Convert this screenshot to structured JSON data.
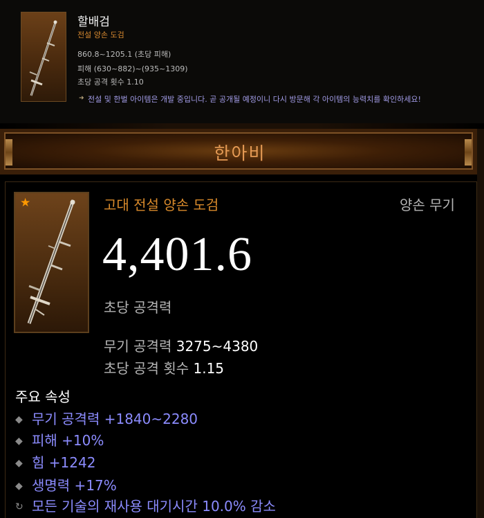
{
  "top_card": {
    "item_name": "할배검",
    "item_type": "전설 양손 도검",
    "line1": "860.8~1205.1 (초당 피해)",
    "line2": "피해 (630~882)~(935~1309)",
    "line3": "초당 공격 횟수 1.10",
    "notice": "전설 및 한벌 아이템은 개발 중입니다. 곧 공개될 예정이니 다시 방문해 각 아이템의 능력치를 확인하세요!",
    "notice_bullet": "➜"
  },
  "tooltip": {
    "header_title": "한아비",
    "item_type": "고대 전설 양손 도검",
    "slot": "양손 무기",
    "dps": "4,401.6",
    "dps_label": "초당 공격력",
    "weapon_damage_label": "무기 공격력",
    "weapon_damage_value": "3275~4380",
    "attack_speed_label": "초당 공격 횟수",
    "attack_speed_value": "1.15",
    "ancient_star": "★",
    "primary_heading": "주요 속성",
    "affixes": [
      {
        "text": "무기 공격력 +1840~2280",
        "bullet": "◆"
      },
      {
        "text": "피해 +10%",
        "bullet": "◆"
      },
      {
        "text": "힘 +1242",
        "bullet": "◆"
      },
      {
        "text": "생명력 +17%",
        "bullet": "◆"
      },
      {
        "text": "모든 기술의 재사용 대기시간 10.0% 감소",
        "bullet": "↻"
      }
    ]
  },
  "colors": {
    "legendary_orange": "#d98a2b",
    "affix_blue": "#8c8cff",
    "notice_purple": "#a09ae4",
    "header_title": "#e69b55"
  },
  "icons": {
    "weapon": "two-handed-sword-icon",
    "ancient": "star-icon",
    "affix": "diamond-bullet-icon",
    "cooldown": "cooldown-icon"
  }
}
